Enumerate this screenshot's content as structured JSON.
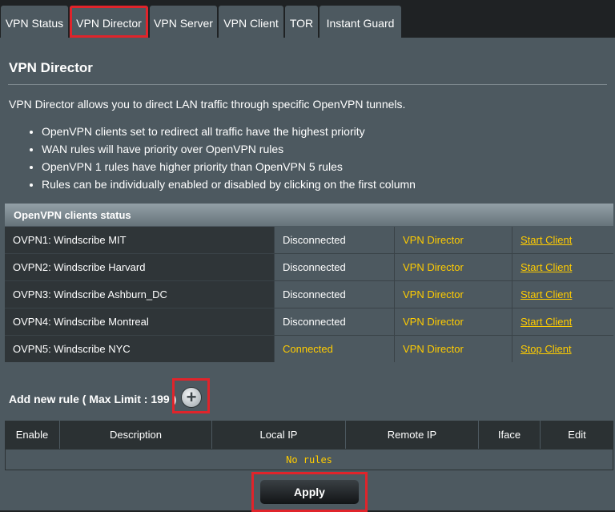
{
  "tabs": [
    {
      "label": "VPN Status"
    },
    {
      "label": "VPN Director"
    },
    {
      "label": "VPN Server"
    },
    {
      "label": "VPN Client"
    },
    {
      "label": "TOR"
    },
    {
      "label": "Instant Guard"
    }
  ],
  "page": {
    "title": "VPN Director",
    "intro": "VPN Director allows you to direct LAN traffic through specific OpenVPN tunnels.",
    "bullets": [
      "OpenVPN clients set to redirect all traffic have the highest priority",
      "WAN rules will have priority over OpenVPN rules",
      "OpenVPN 1 rules have higher priority than OpenVPN 5 rules",
      "Rules can be individually enabled or disabled by clicking on the first column"
    ]
  },
  "clients_status": {
    "header": "OpenVPN clients status",
    "rows": [
      {
        "name": "OVPN1: Windscribe MIT",
        "state": "Disconnected",
        "mode": "VPN Director",
        "action": "Start Client"
      },
      {
        "name": "OVPN2: Windscribe Harvard",
        "state": "Disconnected",
        "mode": "VPN Director",
        "action": "Start Client"
      },
      {
        "name": "OVPN3: Windscribe Ashburn_DC",
        "state": "Disconnected",
        "mode": "VPN Director",
        "action": "Start Client"
      },
      {
        "name": "OVPN4: Windscribe Montreal",
        "state": "Disconnected",
        "mode": "VPN Director",
        "action": "Start Client"
      },
      {
        "name": "OVPN5: Windscribe NYC",
        "state": "Connected",
        "mode": "VPN Director",
        "action": "Stop Client"
      }
    ]
  },
  "rules": {
    "add_label": "Add new rule ( Max Limit : 199 )",
    "add_icon": "plus-circle-icon",
    "columns": [
      "Enable",
      "Description",
      "Local IP",
      "Remote IP",
      "Iface",
      "Edit"
    ],
    "empty_text": "No rules"
  },
  "apply_label": "Apply",
  "colors": {
    "highlight": "#e0242b",
    "accent_yellow": "#ffcc00",
    "panel_bg": "#4d5960"
  }
}
